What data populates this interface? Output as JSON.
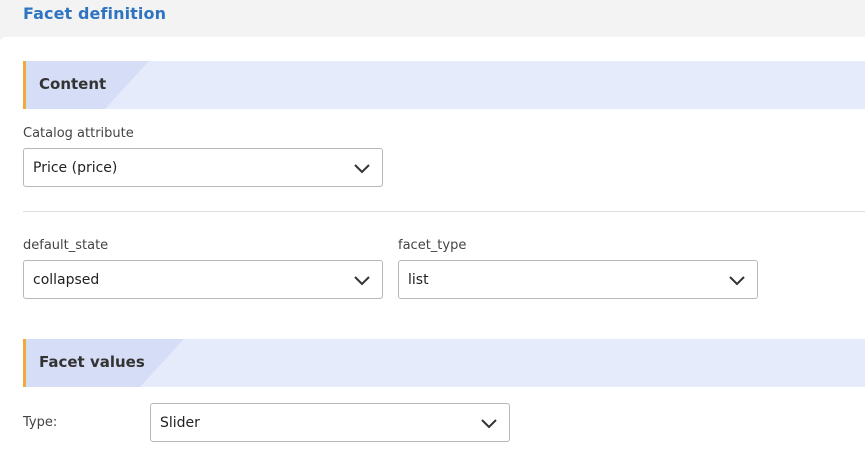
{
  "page": {
    "title": "Facet definition"
  },
  "content_section": {
    "title": "Content",
    "catalog_attribute": {
      "label": "Catalog attribute",
      "value": "Price (price)"
    },
    "default_state": {
      "label": "default_state",
      "value": "collapsed"
    },
    "facet_type": {
      "label": "facet_type",
      "value": "list"
    }
  },
  "facet_values_section": {
    "title": "Facet values",
    "type": {
      "label": "Type:",
      "value": "Slider"
    }
  },
  "colors": {
    "title_blue": "#2f74c0",
    "section_bg": "#e6ebfb",
    "section_tab": "#d6def7",
    "accent": "#f2a93b"
  },
  "icons": {
    "dropdown": "chevron-down-icon"
  }
}
